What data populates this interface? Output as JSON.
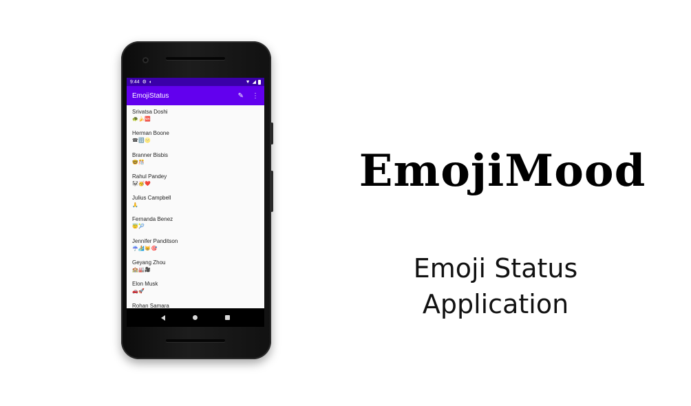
{
  "statusbar": {
    "time": "9:44",
    "icons": [
      "gear-icon",
      "sync-icon",
      "wifi-icon",
      "signal-icon",
      "battery-icon"
    ]
  },
  "appbar": {
    "title": "EmojiStatus",
    "edit_icon": "pencil-icon",
    "menu_icon": "more-vert-icon"
  },
  "users": [
    {
      "name": "Srivatsa Doshi",
      "status": "🐢🍌🆘"
    },
    {
      "name": "Herman Boone",
      "status": "☎🔢🌝"
    },
    {
      "name": "Branner Bisbis",
      "status": "🤓🎊"
    },
    {
      "name": "Rahul Pandey",
      "status": "🐼🥳❤️"
    },
    {
      "name": "Julius Campbell",
      "status": "🙏"
    },
    {
      "name": "Fernanda Benez",
      "status": "😇🎾"
    },
    {
      "name": "Jennifer Panditson",
      "status": "☔🏄😸🎯"
    },
    {
      "name": "Geyang Zhou",
      "status": "🏫🏭🎥"
    },
    {
      "name": "Elon Musk",
      "status": "🚗🚀"
    },
    {
      "name": "Rohan Samara",
      "status": ""
    }
  ],
  "headline": "EmojiMood",
  "subline": {
    "line1": "Emoji Status",
    "line2": "Application"
  },
  "colors": {
    "status_bar": "#3a00a8",
    "app_bar": "#6200ee",
    "list_bg": "#fafafa"
  }
}
